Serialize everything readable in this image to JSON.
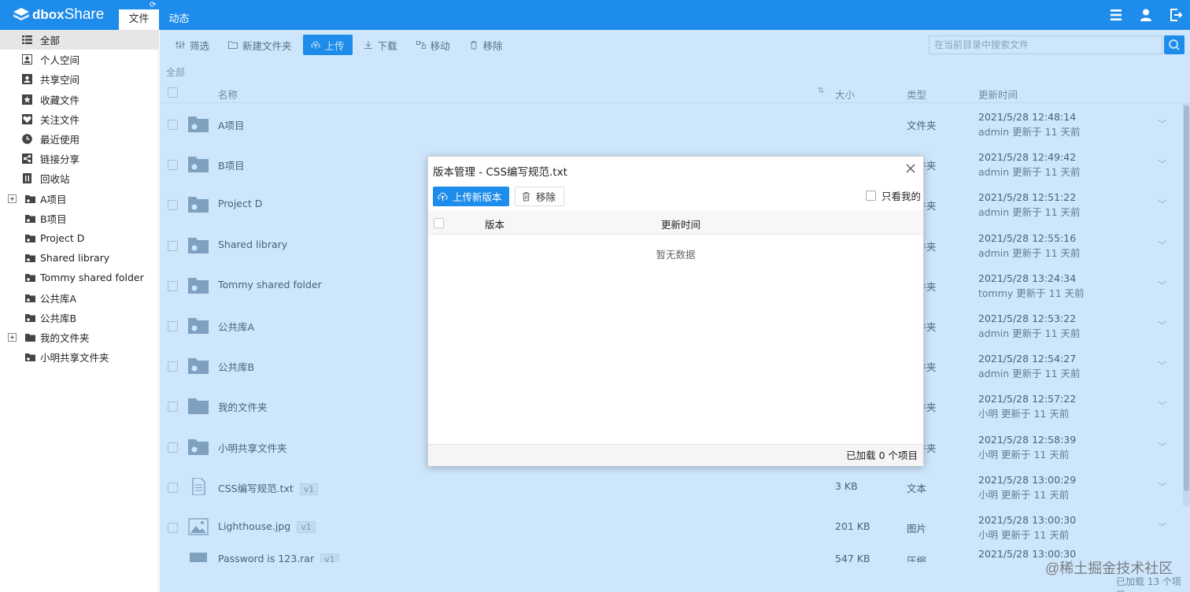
{
  "app": {
    "logo_text": "dbox",
    "logo_text2": "Share"
  },
  "topnav": {
    "tabs": [
      "文件",
      "动态"
    ]
  },
  "sidebar": {
    "items": [
      "全部",
      "个人空间",
      "共享空间",
      "收藏文件",
      "关注文件",
      "最近使用",
      "链接分享",
      "回收站"
    ],
    "tree": [
      "A项目",
      "B项目",
      "Project D",
      "Shared library",
      "Tommy shared folder",
      "公共库A",
      "公共库B",
      "我的文件夹",
      "小明共享文件夹"
    ]
  },
  "toolbar": {
    "buttons": [
      "筛选",
      "新建文件夹",
      "上传",
      "下载",
      "移动",
      "移除"
    ],
    "search_placeholder": "在当前目录中搜索文件"
  },
  "breadcrumb": "全部",
  "table": {
    "headers": {
      "name": "名称",
      "size": "大小",
      "type": "类型",
      "time": "更新时间"
    },
    "rows": [
      {
        "name": "A项目",
        "version": "",
        "size": "",
        "type": "文件夹",
        "time": "2021/5/28 12:48:14",
        "user": "admin 更新于 11 天前"
      },
      {
        "name": "B项目",
        "version": "",
        "size": "",
        "type": "文件夹",
        "time": "2021/5/28 12:49:42",
        "user": "admin 更新于 11 天前"
      },
      {
        "name": "Project D",
        "version": "",
        "size": "",
        "type": "文件夹",
        "time": "2021/5/28 12:51:22",
        "user": "admin 更新于 11 天前"
      },
      {
        "name": "Shared library",
        "version": "",
        "size": "",
        "type": "文件夹",
        "time": "2021/5/28 12:55:16",
        "user": "admin 更新于 11 天前"
      },
      {
        "name": "Tommy shared folder",
        "version": "",
        "size": "",
        "type": "文件夹",
        "time": "2021/5/28 13:24:34",
        "user": "tommy 更新于 11 天前"
      },
      {
        "name": "公共库A",
        "version": "",
        "size": "",
        "type": "文件夹",
        "time": "2021/5/28 12:53:22",
        "user": "admin 更新于 11 天前"
      },
      {
        "name": "公共库B",
        "version": "",
        "size": "",
        "type": "文件夹",
        "time": "2021/5/28 12:54:27",
        "user": "admin 更新于 11 天前"
      },
      {
        "name": "我的文件夹",
        "version": "",
        "size": "",
        "type": "文件夹",
        "time": "2021/5/28 12:57:22",
        "user": "小明 更新于 11 天前"
      },
      {
        "name": "小明共享文件夹",
        "version": "",
        "size": "",
        "type": "文件夹",
        "time": "2021/5/28 12:58:39",
        "user": "小明 更新于 11 天前"
      },
      {
        "name": "CSS编写规范.txt",
        "version": "v1",
        "size": "3 KB",
        "type": "文本",
        "time": "2021/5/28 13:00:29",
        "user": "小明 更新于 11 天前"
      },
      {
        "name": "Lighthouse.jpg",
        "version": "v1",
        "size": "201 KB",
        "type": "图片",
        "time": "2021/5/28 13:00:30",
        "user": "小明 更新于 11 天前"
      },
      {
        "name": "Password is 123.rar",
        "version": "v1",
        "size": "547 KB",
        "type": "压缩",
        "time": "2021/5/28 13:00:30",
        "user": ""
      }
    ]
  },
  "footer": "已加载 13 个项目",
  "dialog": {
    "title": "版本管理 - CSS编写规范.txt",
    "upload_label": "上传新版本",
    "remove_label": "移除",
    "only_mine_label": "只看我的",
    "col_version": "版本",
    "col_time": "更新时间",
    "empty_text": "暂无数据",
    "footer": "已加载 0 个项目"
  },
  "watermark": "@稀土掘金技术社区",
  "colors": {
    "accent": "#1e8ceb",
    "overlay": "rgba(30,140,235,0.22)"
  }
}
